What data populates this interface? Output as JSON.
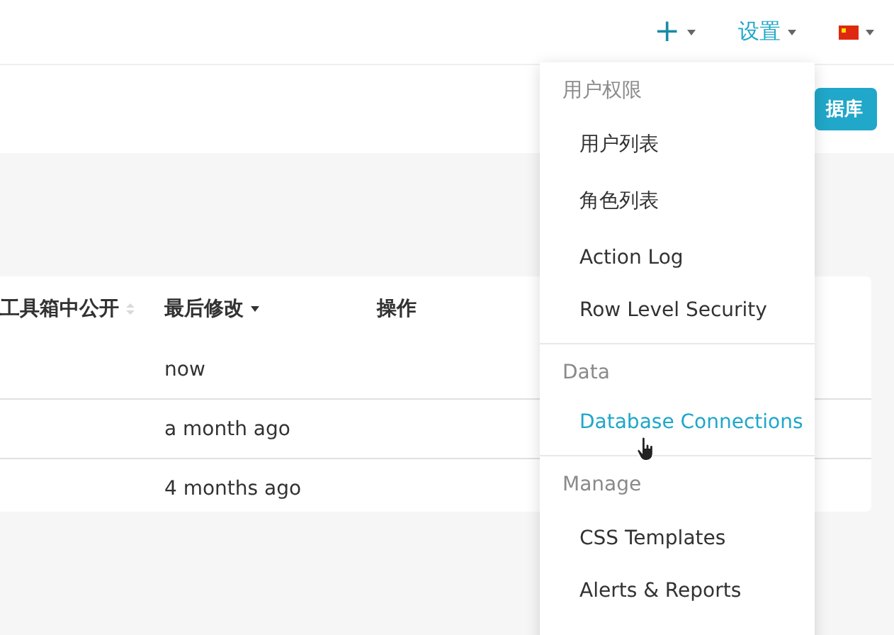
{
  "navbar": {
    "add_icon": "+",
    "settings_label": "设置"
  },
  "subheader": {
    "button": "据库"
  },
  "table": {
    "columns": [
      {
        "label": "工具箱中公开",
        "sorted": false
      },
      {
        "label": "最后修改",
        "sorted": true
      },
      {
        "label": "操作"
      }
    ],
    "rows": [
      {
        "modified": "now"
      },
      {
        "modified": "a month ago"
      },
      {
        "modified": "4 months ago"
      }
    ]
  },
  "menu": {
    "sections": [
      {
        "title": "用户权限",
        "items": [
          {
            "label": "用户列表",
            "selected": false
          },
          {
            "label": "角色列表",
            "selected": false
          },
          {
            "label": "Action Log",
            "selected": false
          },
          {
            "label": "Row Level Security",
            "selected": false
          }
        ]
      },
      {
        "title": "Data",
        "items": [
          {
            "label": "Database Connections",
            "selected": true
          }
        ]
      },
      {
        "title": "Manage",
        "items": [
          {
            "label": "CSS Templates",
            "selected": false
          },
          {
            "label": "Alerts & Reports",
            "selected": false
          }
        ]
      }
    ]
  }
}
